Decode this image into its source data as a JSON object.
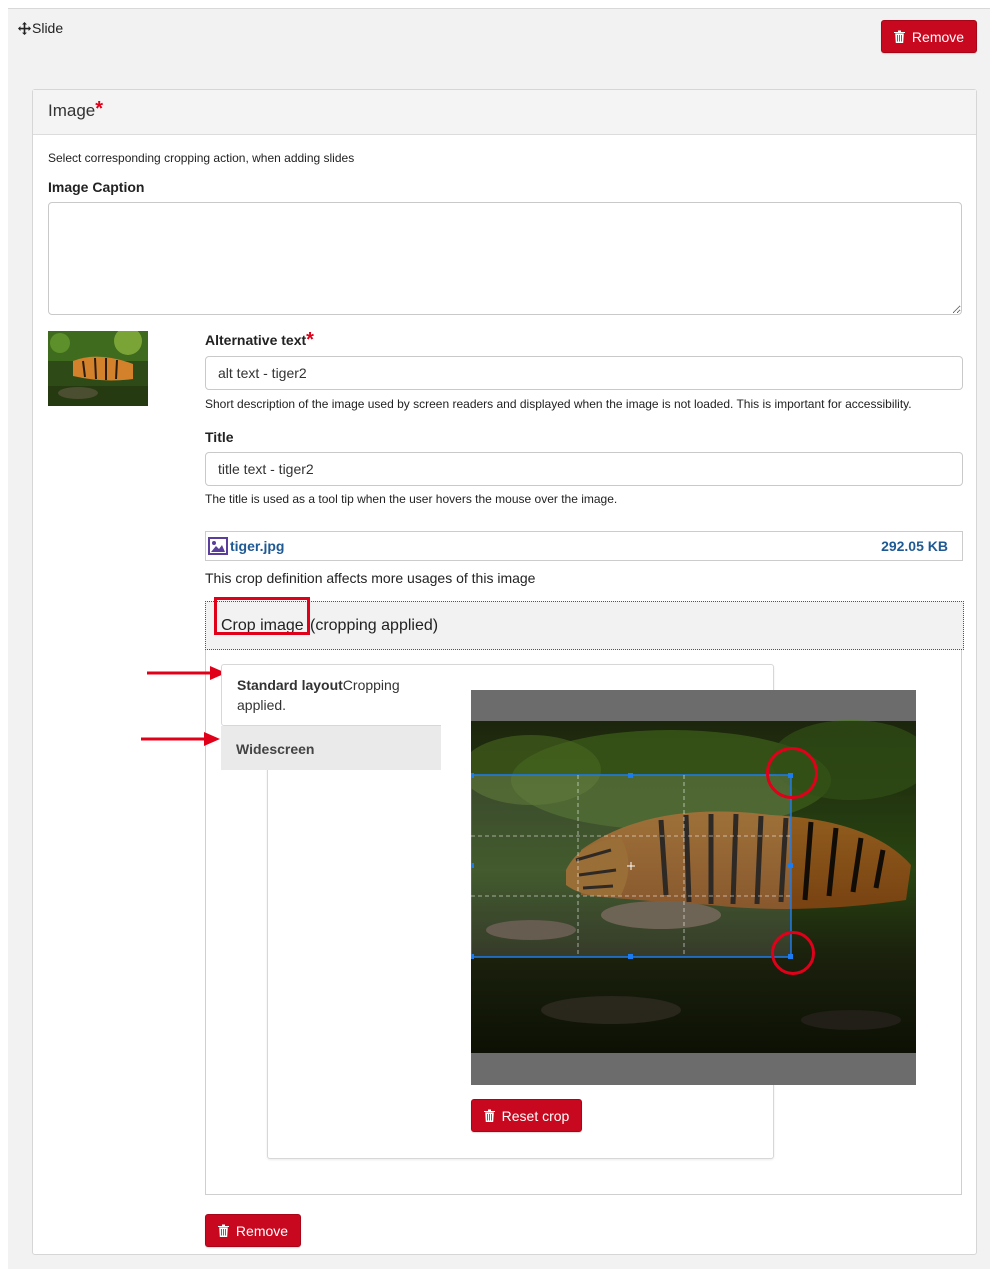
{
  "slide": {
    "handle_label": "Slide",
    "remove_label": "Remove"
  },
  "image_section": {
    "title": "Image",
    "required_mark": "*",
    "help_text": "Select corresponding cropping action, when adding slides",
    "caption_label": "Image Caption",
    "caption_value": "",
    "alt": {
      "label": "Alternative text",
      "required_mark": "*",
      "value": "alt text - tiger2",
      "help": "Short description of the image used by screen readers and displayed when the image is not loaded. This is important for accessibility."
    },
    "title_field": {
      "label": "Title",
      "value": "title text - tiger2",
      "help": "The title is used as a tool tip when the user hovers the mouse over the image."
    },
    "file": {
      "name": "tiger.jpg",
      "size": "292.05 KB"
    },
    "crop_note": "This crop definition affects more usages of this image",
    "crop_toggle": {
      "label": "Crop image",
      "status": "(cropping applied)"
    },
    "crop_tabs": [
      {
        "name": "Standard layout",
        "status_line1": "Cropping",
        "status_line2": "applied.",
        "active": true
      },
      {
        "name": "Widescreen",
        "active": false
      }
    ],
    "reset_crop_label": "Reset crop",
    "remove_label": "Remove"
  },
  "colors": {
    "danger": "#c8081f",
    "annotation": "#e0001a",
    "link": "#1f5993",
    "crop_selection": "#1a7cf0"
  }
}
